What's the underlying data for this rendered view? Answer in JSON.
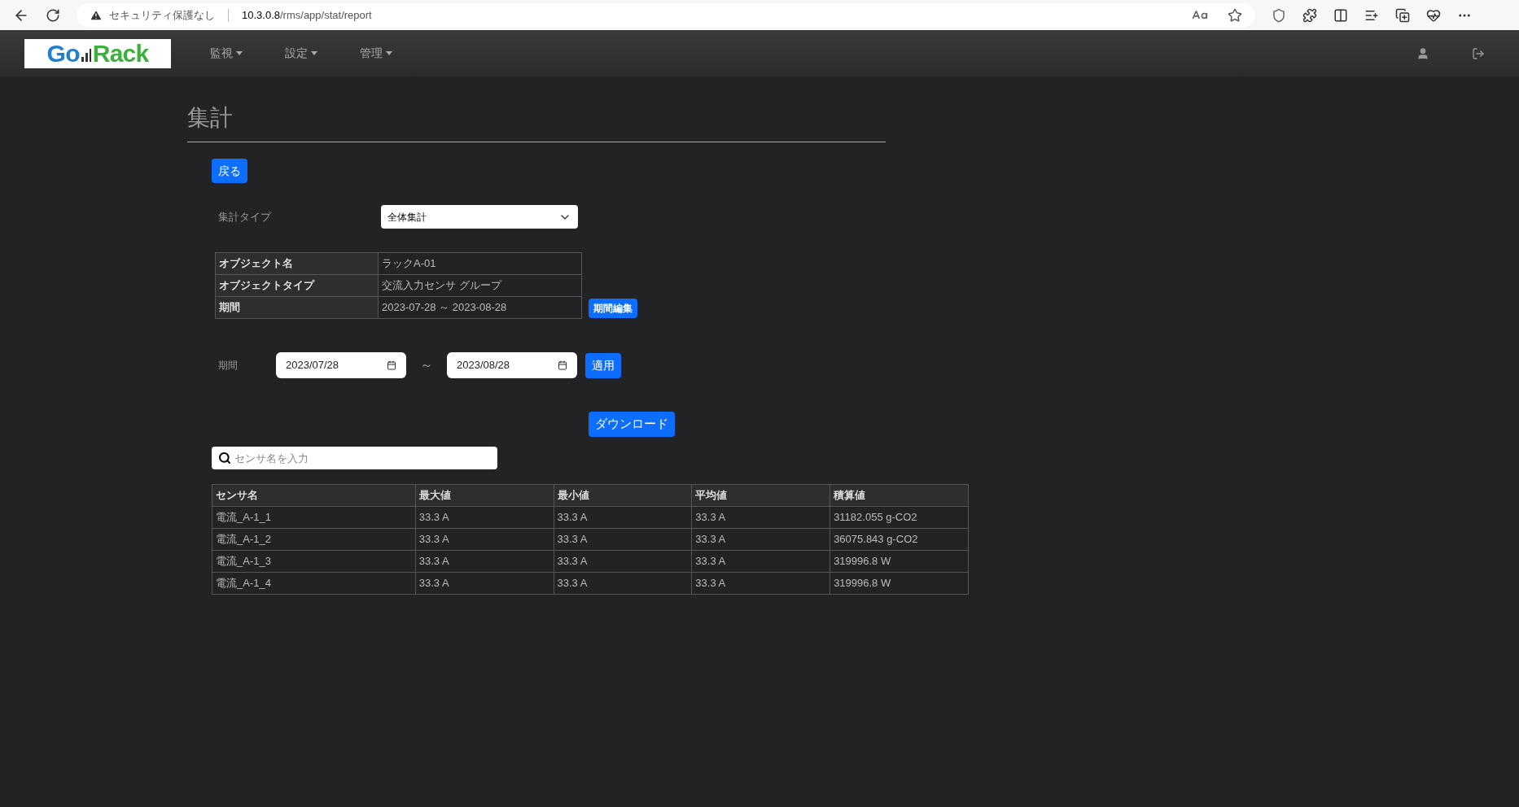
{
  "browser": {
    "security_label": "セキュリティ保護なし",
    "url_host": "10.3.0.8",
    "url_path": "/rms/app/stat/report"
  },
  "navbar": {
    "logo": {
      "part1": "Go",
      "part2": "Rack"
    },
    "menus": [
      {
        "label": "監視"
      },
      {
        "label": "設定"
      },
      {
        "label": "管理"
      }
    ]
  },
  "page": {
    "title": "集計",
    "back_button": "戻る",
    "aggregation_type": {
      "label": "集計タイプ",
      "value": "全体集計"
    },
    "info_table": [
      {
        "label": "オブジェクト名",
        "value": "ラックA-01"
      },
      {
        "label": "オブジェクトタイプ",
        "value": "交流入力センサ グループ"
      },
      {
        "label": "期間",
        "value": "2023-07-28 ～ 2023-08-28"
      }
    ],
    "edit_period_button": "期間編集",
    "period": {
      "label": "期間",
      "from": "2023/07/28",
      "separator": "～",
      "to": "2023/08/28",
      "apply_button": "適用"
    },
    "download_button": "ダウンロード",
    "search": {
      "placeholder": "センサ名を入力"
    },
    "table": {
      "columns": [
        "センサ名",
        "最大値",
        "最小値",
        "平均値",
        "積算値"
      ],
      "rows": [
        [
          "電流_A-1_1",
          "33.3 A",
          "33.3 A",
          "33.3 A",
          "31182.055 g-CO2"
        ],
        [
          "電流_A-1_2",
          "33.3 A",
          "33.3 A",
          "33.3 A",
          "36075.843 g-CO2"
        ],
        [
          "電流_A-1_3",
          "33.3 A",
          "33.3 A",
          "33.3 A",
          "319996.8 W"
        ],
        [
          "電流_A-1_4",
          "33.3 A",
          "33.3 A",
          "33.3 A",
          "319996.8 W"
        ]
      ]
    }
  }
}
